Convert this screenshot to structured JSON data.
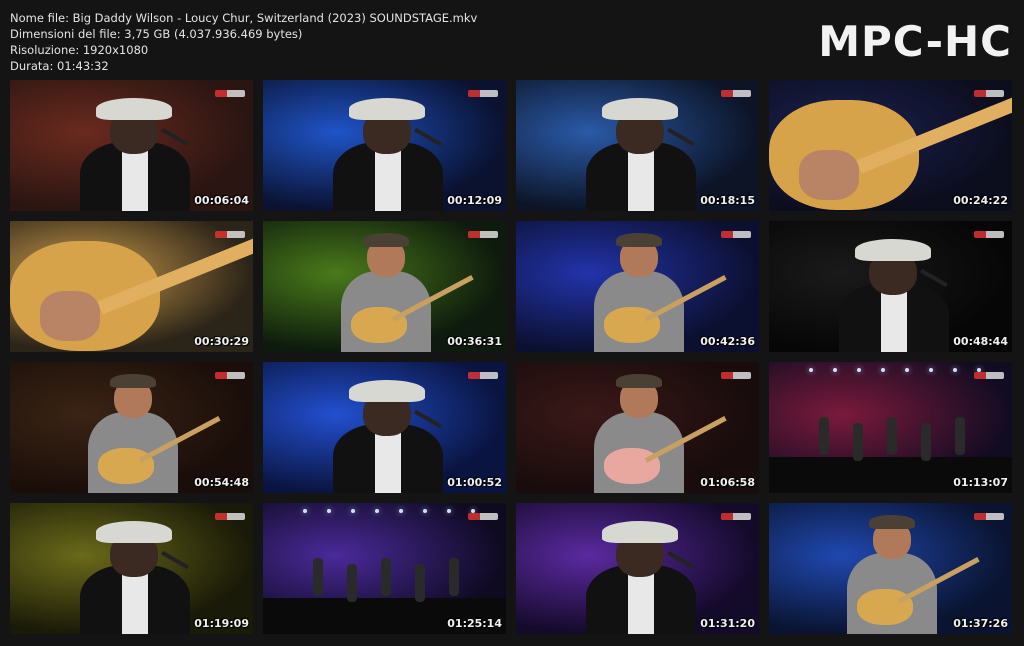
{
  "info": {
    "line1": "Nome file: Big Daddy Wilson - Loucy Chur, Switzerland (2023) SOUNDSTAGE.mkv",
    "line2": "Dimensioni del file: 3,75 GB (4.037.936.469 bytes)",
    "line3": "Risoluzione: 1920x1080",
    "line4": "Durata: 01:43:32"
  },
  "logo": "MPC-HC",
  "thumbnails": [
    {
      "time": "00:06:04",
      "bg": "#2a1512",
      "light": "#6a2a1e",
      "scene": "singer-hat-dark"
    },
    {
      "time": "00:12:09",
      "bg": "#0a1230",
      "light": "#1f54c8",
      "scene": "singer-hat-blue"
    },
    {
      "time": "00:18:15",
      "bg": "#0c1426",
      "light": "#2a5aa8",
      "scene": "singer-hat-blue"
    },
    {
      "time": "00:24:22",
      "bg": "#0c0e1e",
      "light": "#1a2050",
      "scene": "guitar-closeup"
    },
    {
      "time": "00:30:29",
      "bg": "#2b2418",
      "light": "#c99a4a",
      "scene": "guitar-neck"
    },
    {
      "time": "00:36:31",
      "bg": "#0d1a0d",
      "light": "#4a7a1a",
      "scene": "guitarist-green"
    },
    {
      "time": "00:42:36",
      "bg": "#0c1030",
      "light": "#2233aa",
      "scene": "guitarist-blue"
    },
    {
      "time": "00:48:44",
      "bg": "#060606",
      "light": "#1a1a1a",
      "scene": "singer-hat-dark"
    },
    {
      "time": "00:54:48",
      "bg": "#1a0e0a",
      "light": "#3a2414",
      "scene": "guitarist-green"
    },
    {
      "time": "01:00:52",
      "bg": "#0a1440",
      "light": "#2250d0",
      "scene": "singer-hat-blue"
    },
    {
      "time": "01:06:58",
      "bg": "#180c0c",
      "light": "#3a1818",
      "scene": "guitarist-red"
    },
    {
      "time": "01:13:07",
      "bg": "#120c22",
      "light": "#7a1a3a",
      "scene": "stage-wide"
    },
    {
      "time": "01:19:09",
      "bg": "#1a1a08",
      "light": "#6a6a1a",
      "scene": "singer-hat-dark"
    },
    {
      "time": "01:25:14",
      "bg": "#0e0a20",
      "light": "#4a2a9a",
      "scene": "stage-wide"
    },
    {
      "time": "01:31:20",
      "bg": "#140a2a",
      "light": "#5a2aa0",
      "scene": "singer-hat-blue"
    },
    {
      "time": "01:37:26",
      "bg": "#0a1430",
      "light": "#1f48b0",
      "scene": "guitarist-blue"
    }
  ]
}
